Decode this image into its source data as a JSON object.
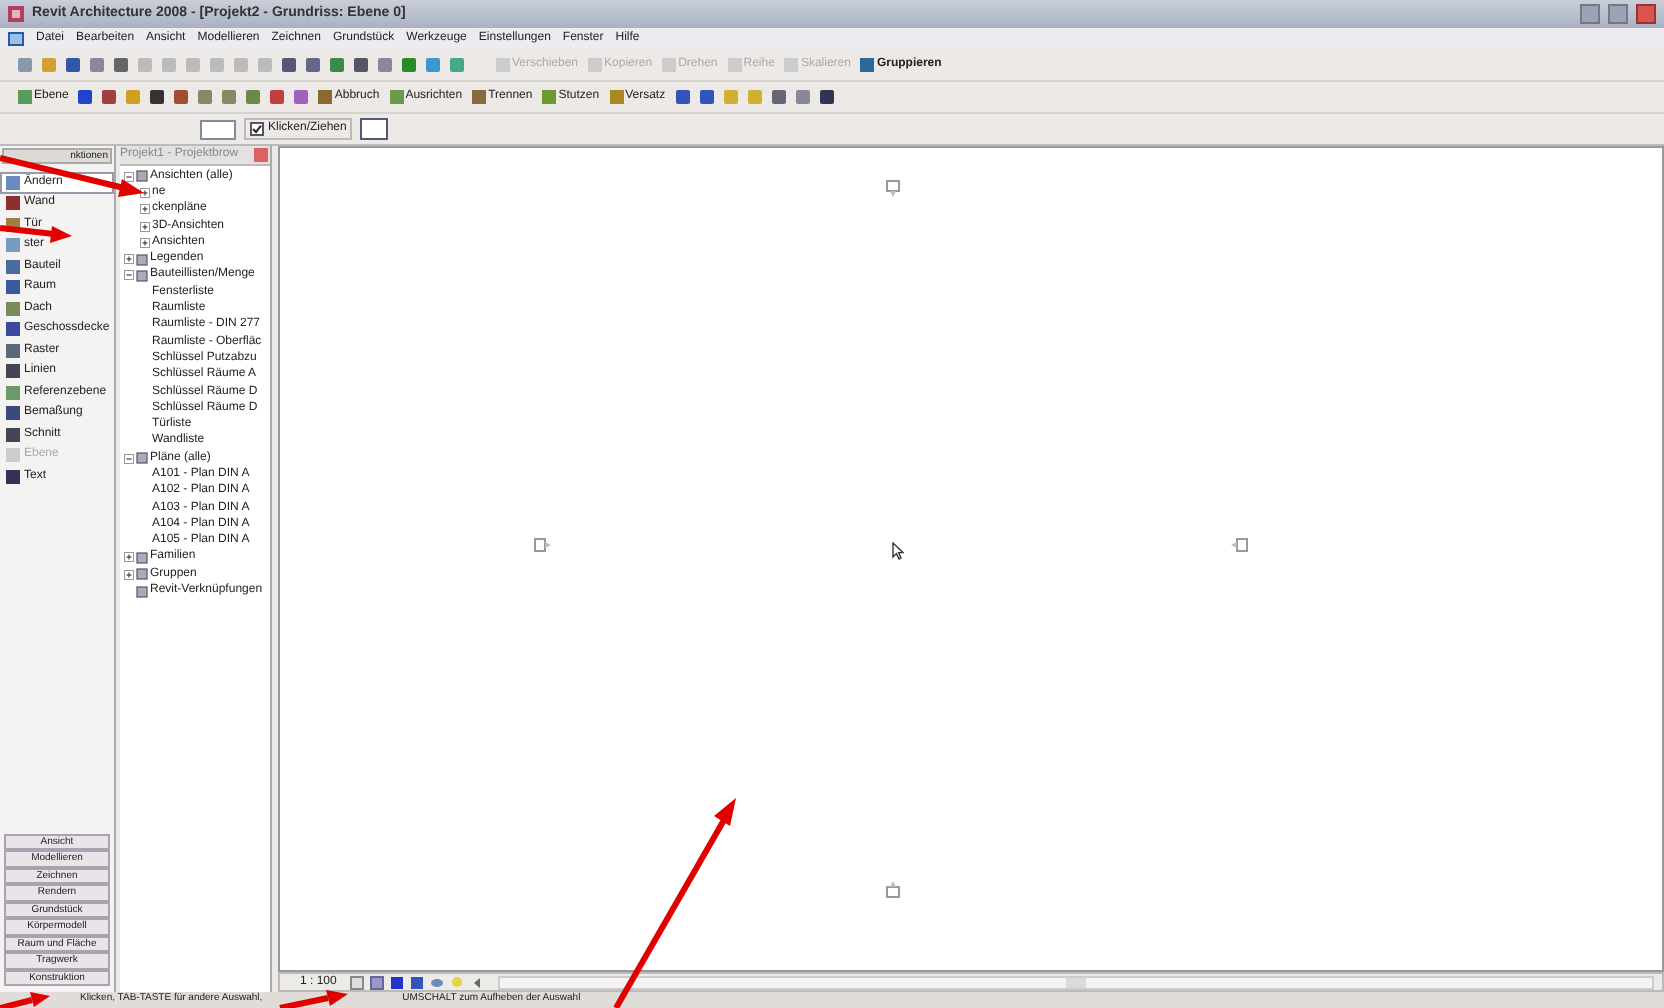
{
  "window": {
    "title": "Revit Architecture 2008 - [Projekt2 - Grundriss: Ebene 0]"
  },
  "menu": [
    "Datei",
    "Bearbeiten",
    "Ansicht",
    "Modellieren",
    "Zeichnen",
    "Grundstück",
    "Werkzeuge",
    "Einstellungen",
    "Fenster",
    "Hilfe"
  ],
  "toolbar_1": [
    {
      "label": "Verschieben",
      "disabled": true
    },
    {
      "label": "Kopieren",
      "disabled": true
    },
    {
      "label": "Drehen",
      "disabled": true
    },
    {
      "label": "Reihe",
      "disabled": true
    },
    {
      "label": "Skalieren",
      "disabled": true
    },
    {
      "label": "Gruppieren",
      "disabled": false
    }
  ],
  "toolbar_2": [
    {
      "label": "Ebene"
    },
    {
      "label": "Abbruch"
    },
    {
      "label": "Ausrichten"
    },
    {
      "label": "Trennen"
    },
    {
      "label": "Stutzen"
    },
    {
      "label": "Versatz"
    }
  ],
  "options_bar": {
    "checkbox": {
      "label": "Klicken/Ziehen",
      "checked": true
    }
  },
  "design_bar": {
    "header": "nktionen",
    "items": [
      {
        "label": "Ändern",
        "selected": true,
        "disabled": false
      },
      {
        "label": "Wand",
        "selected": false,
        "disabled": false
      },
      {
        "label": "Tür",
        "selected": false,
        "disabled": false
      },
      {
        "label": "ster",
        "selected": false,
        "disabled": false
      },
      {
        "label": "Bauteil",
        "selected": false,
        "disabled": false
      },
      {
        "label": "Raum",
        "selected": false,
        "disabled": false
      },
      {
        "label": "Dach",
        "selected": false,
        "disabled": false
      },
      {
        "label": "Geschossdecke",
        "selected": false,
        "disabled": false
      },
      {
        "label": "Raster",
        "selected": false,
        "disabled": false
      },
      {
        "label": "Linien",
        "selected": false,
        "disabled": false
      },
      {
        "label": "Referenzebene",
        "selected": false,
        "disabled": false
      },
      {
        "label": "Bemaßung",
        "selected": false,
        "disabled": false
      },
      {
        "label": "Schnitt",
        "selected": false,
        "disabled": false
      },
      {
        "label": "Ebene",
        "selected": false,
        "disabled": true
      },
      {
        "label": "Text",
        "selected": false,
        "disabled": false
      }
    ],
    "tabs": [
      "Ansicht",
      "Modellieren",
      "Zeichnen",
      "Rendern",
      "Grundstück",
      "Körpermodell",
      "Raum und Fläche",
      "Tragwerk",
      "Konstruktion"
    ]
  },
  "project_browser": {
    "title": "Projekt1 - Projektbrow",
    "tree": [
      {
        "label": "Ansichten (alle)",
        "expanded": true,
        "children": [
          {
            "label": "ne",
            "expanded": false
          },
          {
            "label": "ckenpläne",
            "expanded": false
          },
          {
            "label": "3D-Ansichten",
            "expanded": false
          },
          {
            "label": "Ansichten",
            "expanded": false
          }
        ]
      },
      {
        "label": "Legenden",
        "expanded": false
      },
      {
        "label": "Bauteillisten/Menge",
        "expanded": true,
        "children": [
          {
            "label": "Fensterliste"
          },
          {
            "label": "Raumliste"
          },
          {
            "label": "Raumliste - DIN 277"
          },
          {
            "label": "Raumliste - Oberfläc"
          },
          {
            "label": "Schlüssel Putzabzu"
          },
          {
            "label": "Schlüssel Räume A"
          },
          {
            "label": "Schlüssel Räume D"
          },
          {
            "label": "Schlüssel Räume D"
          },
          {
            "label": "Türliste"
          },
          {
            "label": "Wandliste"
          }
        ]
      },
      {
        "label": "Pläne (alle)",
        "expanded": true,
        "children": [
          {
            "label": "A101 - Plan DIN A"
          },
          {
            "label": "A102 - Plan DIN A"
          },
          {
            "label": "A103 - Plan DIN A"
          },
          {
            "label": "A104 - Plan DIN A"
          },
          {
            "label": "A105 - Plan DIN A"
          }
        ]
      },
      {
        "label": "Familien",
        "expanded": false
      },
      {
        "label": "Gruppen",
        "expanded": false
      },
      {
        "label": "Revit-Verknüpfungen"
      }
    ]
  },
  "view_bar": {
    "scale": "1 : 100"
  },
  "status_bar": {
    "left": "Klicken, TAB-TASTE für andere Auswahl,",
    "right": "UMSCHALT zum Aufheben der Auswahl"
  }
}
